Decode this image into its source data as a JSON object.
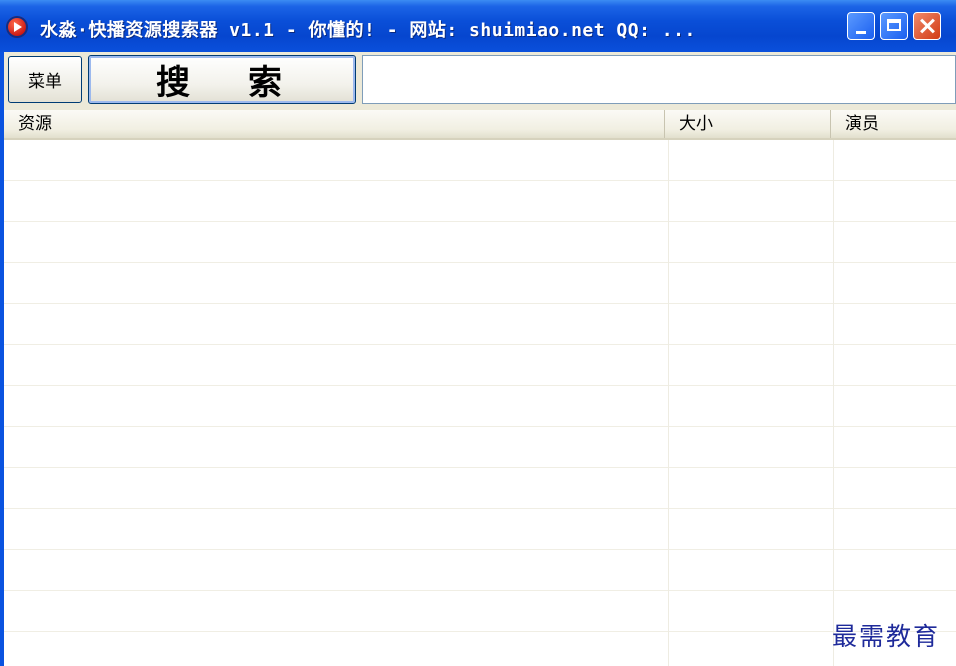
{
  "window": {
    "title": "水淼·快播资源搜索器 v1.1 - 你懂的! - 网站: shuimiao.net QQ: ...",
    "icon": "player-icon",
    "controls": [
      "minimize-icon",
      "maximize-icon",
      "close-icon"
    ]
  },
  "toolbar": {
    "menu_label": "菜单",
    "search_label": "搜索",
    "search_input_value": ""
  },
  "list": {
    "columns": [
      {
        "label": "资源"
      },
      {
        "label": "大小"
      },
      {
        "label": "演员"
      }
    ],
    "rows": []
  },
  "watermark": "最需教育",
  "colors": {
    "titlebar": "#0a4fd8",
    "window_bg": "#ece9d8",
    "list_bg": "#ffffff"
  }
}
